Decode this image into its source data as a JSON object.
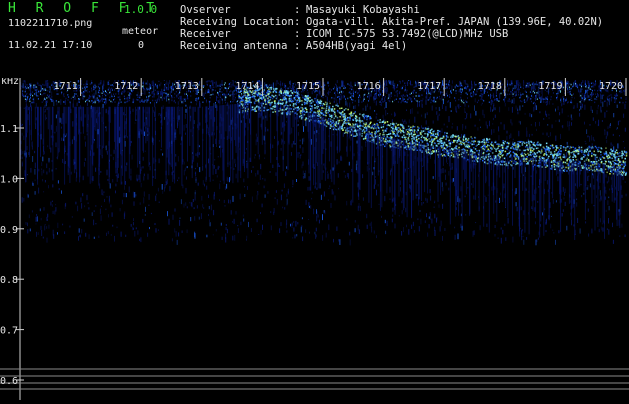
{
  "app": {
    "title": "H R O F F T",
    "version": "1.0.0"
  },
  "file": {
    "name": "1102211710.png",
    "datetime": "11.02.21 17:10"
  },
  "meteor": {
    "label": "meteor",
    "count": "0"
  },
  "info": [
    {
      "key": "Ovserver",
      "value": "Masayuki Kobayashi"
    },
    {
      "key": "Receiving Location",
      "value": "Ogata-vill. Akita-Pref. JAPAN (139.96E, 40.02N)"
    },
    {
      "key": "Receiver",
      "value": "ICOM IC-575 53.7492(@LCD)MHz USB"
    },
    {
      "key": "Receiving antenna",
      "value": "A504HB(yagi 4el)"
    }
  ],
  "chart_data": {
    "type": "heatmap",
    "ylabel": "kHz",
    "y_ticks": [
      "1.1",
      "1.0",
      "0.9",
      "0.8",
      "0.7",
      "0.6"
    ],
    "x_ticks": [
      "1711",
      "1712",
      "1713",
      "1714",
      "1715",
      "1716",
      "1717",
      "1718",
      "1719",
      "1720"
    ],
    "series": [
      {
        "x": [
          1710.0,
          1711.0,
          1712.0,
          1713.0,
          1714.0,
          1714.5,
          1715.0,
          1715.5,
          1716.0,
          1716.5,
          1717.0,
          1717.5,
          1718.0,
          1718.5,
          1719.0,
          1719.5,
          1720.0
        ],
        "y": [
          1.15,
          1.15,
          1.15,
          1.15,
          1.16,
          1.15,
          1.13,
          1.11,
          1.09,
          1.08,
          1.07,
          1.06,
          1.05,
          1.05,
          1.04,
          1.04,
          1.03
        ]
      }
    ],
    "colors": {
      "background": "#000000",
      "low": "#0a1a7a",
      "mid": "#1e64ff",
      "high": "#78e6ff",
      "peak": "#c8ff78"
    }
  }
}
